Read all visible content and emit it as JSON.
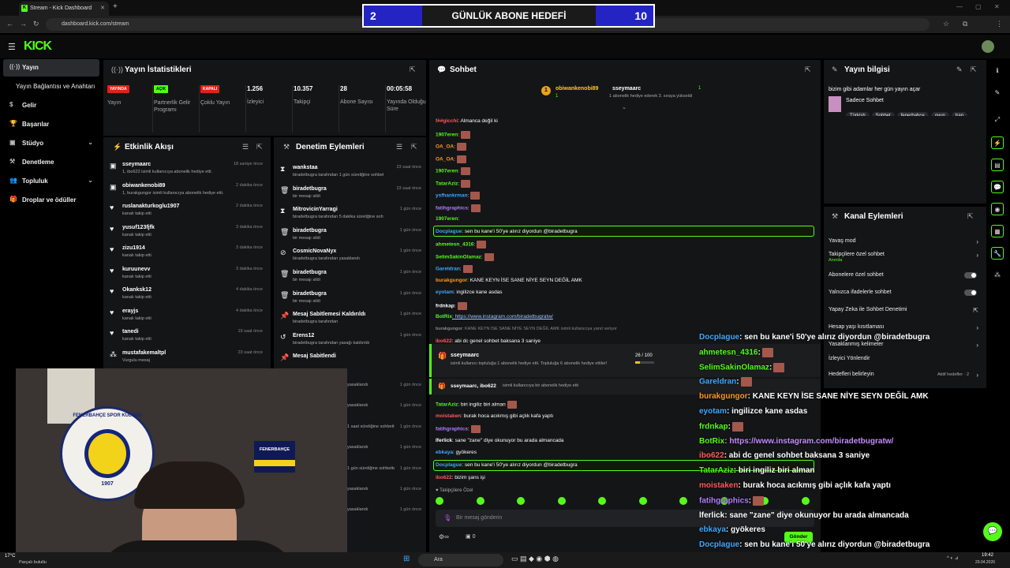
{
  "browser": {
    "tab_title": "Stream - Kick Dashboard",
    "url": "dashboard.kick.com/stream",
    "favicon_letter": "K"
  },
  "goal_banner": {
    "left": "2",
    "title": "GÜNLÜK ABONE HEDEFİ",
    "right": "10"
  },
  "site": {
    "logo": "KICK"
  },
  "sidebar": {
    "items": [
      {
        "label": "Yayın"
      },
      {
        "label": "Yayın Bağlantısı ve Anahtarı"
      },
      {
        "label": "Gelir"
      },
      {
        "label": "Başarılar"
      },
      {
        "label": "Stüdyo"
      },
      {
        "label": "Denetleme"
      },
      {
        "label": "Topluluk"
      },
      {
        "label": "Droplar ve ödüller"
      }
    ]
  },
  "stats": {
    "title": "Yayın İstatistikleri",
    "cells": [
      {
        "badge": "YAYINDA",
        "label": "Yayın"
      },
      {
        "badge": "AÇIK",
        "label": "Partnerlik Gelir Programı"
      },
      {
        "badge": "KAPALI",
        "label": "Çoklu Yayın"
      },
      {
        "value": "1.256",
        "label": "İzleyici"
      },
      {
        "value": "10.357",
        "label": "Takipçi"
      },
      {
        "value": "28",
        "label": "Abone Sayısı"
      },
      {
        "value": "00:05:58",
        "label": "Yayında Olduğu Süre"
      }
    ]
  },
  "activity": {
    "title": "Etkinlik Akışı",
    "rows": [
      {
        "name": "sseymaarc",
        "desc": "1, ibo622 isimli kullanıcıya abonelik hediye etti.",
        "time": "18 saniye önce"
      },
      {
        "name": "obiwankenobi89",
        "desc": "1, burakgungor isimli kullanıcıya abonelik hediye etti.",
        "time": "2 dakika önce"
      },
      {
        "name": "ruslanakturkoglu1907",
        "desc": "kanalı takip etti",
        "time": "2 dakika önce"
      },
      {
        "name": "yusuf123fjfk",
        "desc": "kanalı takip etti",
        "time": "3 dakika önce"
      },
      {
        "name": "zizu1914",
        "desc": "kanalı takip etti",
        "time": "3 dakika önce"
      },
      {
        "name": "kuruunevv",
        "desc": "kanalı takip etti",
        "time": "3 dakika önce"
      },
      {
        "name": "Okanksk12",
        "desc": "kanalı takip etti",
        "time": "4 dakika önce"
      },
      {
        "name": "erayjs",
        "desc": "kanalı takip etti",
        "time": "4 dakika önce"
      },
      {
        "name": "tanedi",
        "desc": "kanalı takip etti",
        "time": "19 saat önce"
      },
      {
        "name": "mustafakemaltpl",
        "desc": "Vurgulu mesaj",
        "time": "23 saat önce"
      }
    ]
  },
  "moderation": {
    "title": "Denetim Eylemleri",
    "rows": [
      {
        "name": "wankstaa",
        "desc": "biradetbugra tarafından 1 gün süreliğine sohbetten uzaklaştırıldı",
        "time": "23 saat önce"
      },
      {
        "name": "biradetbugra",
        "desc": "bir mesajı sildi",
        "time": "23 saat önce"
      },
      {
        "name": "MitrovicinYarragi",
        "desc": "biradetbugra tarafından 5 dakika süreliğine sohbetten uzaklaştırıldı",
        "time": "1 gün önce"
      },
      {
        "name": "biradetbugra",
        "desc": "bir mesajı sildi",
        "time": "1 gün önce"
      },
      {
        "name": "CosmicNovaNyx",
        "desc": "biradetbugra tarafından yasaklandı",
        "time": "1 gün önce"
      },
      {
        "name": "biradetbugra",
        "desc": "bir mesajı sildi",
        "time": "1 gün önce"
      },
      {
        "name": "biradetbugra",
        "desc": "bir mesajı sildi",
        "time": "1 gün önce"
      },
      {
        "name": "Mesaj Sabitlemesi Kaldırıldı",
        "desc": "biradetbugra tarafından",
        "time": "1 gün önce"
      },
      {
        "name": "Erens12",
        "desc": "biradetbugra tarafından yasağı kaldırıldı",
        "time": "1 gün önce"
      },
      {
        "name": "Mesaj Sabitlendi",
        "desc": "",
        "time": ""
      }
    ],
    "partial": [
      {
        "desc": "yasaklandı",
        "time": "1 gün önce"
      },
      {
        "desc": "yasaklandı",
        "time": "1 gün önce"
      },
      {
        "desc": "1 saat süreliğine sohbetten",
        "time": "1 gün önce"
      },
      {
        "desc": "yasaklandı",
        "time": "1 gün önce"
      },
      {
        "desc": "1 gün süreliğine sohbetten",
        "time": "1 gün önce"
      },
      {
        "desc": "yasaklandı",
        "time": "1 gün önce"
      },
      {
        "desc": "yasaklandı",
        "time": "1 gün önce"
      }
    ]
  },
  "chat": {
    "title": "Sohbet",
    "top_gifters": [
      {
        "rank": "1",
        "name": "obiwankenobi89",
        "count": "1"
      },
      {
        "name": "sseymaarc",
        "count": "1",
        "note": "1 abonelik hediye ederek 3. sıraya yükseldi"
      }
    ],
    "lines": [
      {
        "user": "f##gicchi",
        "color": "#ff5a5a",
        "text": ": Almanca değil ki",
        "emote": false
      },
      {
        "user": "1907eren",
        "color": "#53fc18",
        "text": ":",
        "emote": true
      },
      {
        "user": "OA_OA",
        "color": "#ff9a1f",
        "text": ":",
        "emote": true
      },
      {
        "user": "OA_OA",
        "color": "#ff9a1f",
        "text": ":",
        "emote": true
      },
      {
        "user": "1907eren",
        "color": "#53fc18",
        "text": ":",
        "emote": true
      },
      {
        "user": "TatarAziz",
        "color": "#53fc18",
        "text": ":",
        "emote": true
      },
      {
        "user": "ysfhankrman",
        "color": "#3fa9ff",
        "text": ":",
        "emote": true
      },
      {
        "user": "fatihgraphics",
        "color": "#b17cff",
        "text": ":",
        "emote": true
      },
      {
        "user": "1907eren",
        "color": "#53fc18",
        "text": ":",
        "emote": false
      },
      {
        "user": "Docplague",
        "color": "#3fa9ff",
        "text": ": sen bu kane'i 50'ye alırız diyordun @biradetbugra",
        "emote": false
      },
      {
        "user": "ahmetesn_4316",
        "color": "#53fc18",
        "text": ":",
        "emote": true
      },
      {
        "user": "SelimSakinOlamaz",
        "color": "#53fc18",
        "text": ":",
        "emote": true
      },
      {
        "user": "Gareldran",
        "color": "#3fa9ff",
        "text": ":",
        "emote": true
      },
      {
        "user": "burakgungor",
        "color": "#ff9a1f",
        "text": ": KANE KEYN İSE SANE NİYE SEYN DEĞİL AMK",
        "emote": false
      },
      {
        "user": "eyotam",
        "color": "#3fa9ff",
        "text": ": ingilizce kane asdas",
        "emote": false
      },
      {
        "user": "frdnkap",
        "color": "#fff",
        "text": ":",
        "emote": true
      },
      {
        "user": "BotRix",
        "color": "#53fc18",
        "text": ": https://www.instagram.com/biradetbugratw/",
        "emote": false
      },
      {
        "user": "burakgungor",
        "color": "#888",
        "text": ": KANE KEYN İSE SANE NİYE SEYN DEĞİL AMK isimli kullanıcıya yanıt veriyor",
        "emote": false
      },
      {
        "user": "ibo622",
        "color": "#ff5a5a",
        "text": ": abi dc genel sohbet baksana 3 saniye",
        "emote": false
      }
    ],
    "gift_card": {
      "user": "sseymaarc",
      "text": "isimli kullanıcı topluluğa 1 abonelik hediye etti. Topluluğa 6 abonelik hediye ettiler!",
      "progress": "26 / 100",
      "progress_fraction": 0.26
    },
    "gift_card2": {
      "users": "sseymaarc, ibo622",
      "text": "isimli kullanıcıya bir abonelik hediye etti"
    },
    "lines2": [
      {
        "user": "TatarAziz",
        "color": "#53fc18",
        "text": ": biri ingiliz biri alman",
        "emote": true
      },
      {
        "user": "moistaken",
        "color": "#ff5a5a",
        "text": ": burak hoca acıkmış gibi açlık kafa yaptı",
        "emote": false
      },
      {
        "user": "fatihgraphics",
        "color": "#b17cff",
        "text": ":",
        "emote": true
      },
      {
        "user": "lferlick",
        "color": "#fff",
        "text": ": sane \"zane\" diye okunuyor bu arada almancada",
        "emote": false
      },
      {
        "user": "ebkaya",
        "color": "#3fa9ff",
        "text": ": gyökeres",
        "emote": false
      }
    ],
    "highlight2": {
      "user": "Docplague",
      "text": ": sen bu kane'i 50'ye alırız diyordun @biradetbugra"
    },
    "last": {
      "user": "ibo622",
      "text": ": bizim şans işi"
    },
    "followers_only": "Takipçilere Özel",
    "input_placeholder": "Bir mesaj gönderin",
    "send_label": "Gönder",
    "counter": "0"
  },
  "info": {
    "title": "Yayın bilgisi",
    "stream_title": "bizim gibi adamlar her gün yayın açar",
    "category": "Sadece Sohbet",
    "tags": [
      "Türkish",
      "Sohbet",
      "fenerbahçe",
      "oyun",
      "tran"
    ]
  },
  "channel_actions": {
    "title": "Kanal Eylemleri",
    "items": [
      {
        "label": "Yavaş mod",
        "sub": ""
      },
      {
        "label": "Takipçilere özel sohbet",
        "sub": "Anında"
      },
      {
        "label": "Abonelere özel sohbet",
        "sub": ""
      },
      {
        "label": "Yalnızca ifadelerle sohbet",
        "sub": ""
      },
      {
        "label": "Yapay Zeka ile Sohbet Denetimi",
        "sub": ""
      },
      {
        "label": "Hesap yaşı kısıtlaması",
        "sub": ""
      },
      {
        "label": "Yasaklanmış kelimeler",
        "sub": ""
      },
      {
        "label": "İzleyici Yönlendir",
        "sub": ""
      },
      {
        "label": "Hedefleri belirleyin",
        "sub": "",
        "extra": "Aktif hedefler · 2"
      }
    ]
  },
  "overlay": {
    "lines": [
      {
        "user": "Docplague",
        "color": "#3fa9ff",
        "text": ": sen bu kane'i 50'ye alırız diyordun @biradetbugra"
      },
      {
        "user": "ahmetesn_4316",
        "color": "#53fc18",
        "text": ":"
      },
      {
        "user": "SelimSakinOlamaz",
        "color": "#53fc18",
        "text": ":"
      },
      {
        "user": "Gareldran",
        "color": "#3fa9ff",
        "text": ":"
      },
      {
        "user": "burakgungor",
        "color": "#ff9a1f",
        "text": ": KANE KEYN İSE SANE NİYE SEYN DEĞİL AMK"
      },
      {
        "user": "eyotam",
        "color": "#3fa9ff",
        "text": ": ingilizce kane asdas"
      },
      {
        "user": "frdnkap",
        "color": "#53fc18",
        "text": ":"
      },
      {
        "user": "BotRix",
        "color": "#53fc18",
        "text": ": https://www.instagram.com/biradetbugratw/"
      },
      {
        "user": "ibo622",
        "color": "#ff5a5a",
        "text": ": abi dc genel sohbet baksana 3 saniye"
      },
      {
        "user": "TatarAziz",
        "color": "#53fc18",
        "text": ": biri ingiliz biri alman"
      },
      {
        "user": "moistaken",
        "color": "#ff5a5a",
        "text": ": burak hoca acıkmış gibi açlık kafa yaptı"
      },
      {
        "user": "fatihgraphics",
        "color": "#b17cff",
        "text": ":"
      },
      {
        "user": "lferlick",
        "color": "#fff",
        "text": ": sane \"zane\" diye okunuyor bu arada almancada"
      },
      {
        "user": "ebkaya",
        "color": "#3fa9ff",
        "text": ": gyökeres"
      },
      {
        "user": "Docplague",
        "color": "#3fa9ff",
        "text": ": sen bu kane'i 50'ye alırız diyordun @biradetbugra"
      },
      {
        "user": "ibo622",
        "color": "#ff5a5a",
        "text": ": bizim şans işi"
      }
    ]
  },
  "camera": {
    "scarf_text": "FENERBAHÇE",
    "crest_text": "FENERBAHÇE SPOR KULÜBÜ",
    "crest_year": "1907"
  },
  "taskbar": {
    "weather_temp": "17°C",
    "weather_desc": "Parçalı bulutlu",
    "search": "Ara",
    "time": "19:42",
    "date": "29.04.2026"
  },
  "colors": {
    "accent": "#53fc18",
    "panel": "#141517",
    "bg": "#000000",
    "goal_blue": "#2424c4"
  }
}
